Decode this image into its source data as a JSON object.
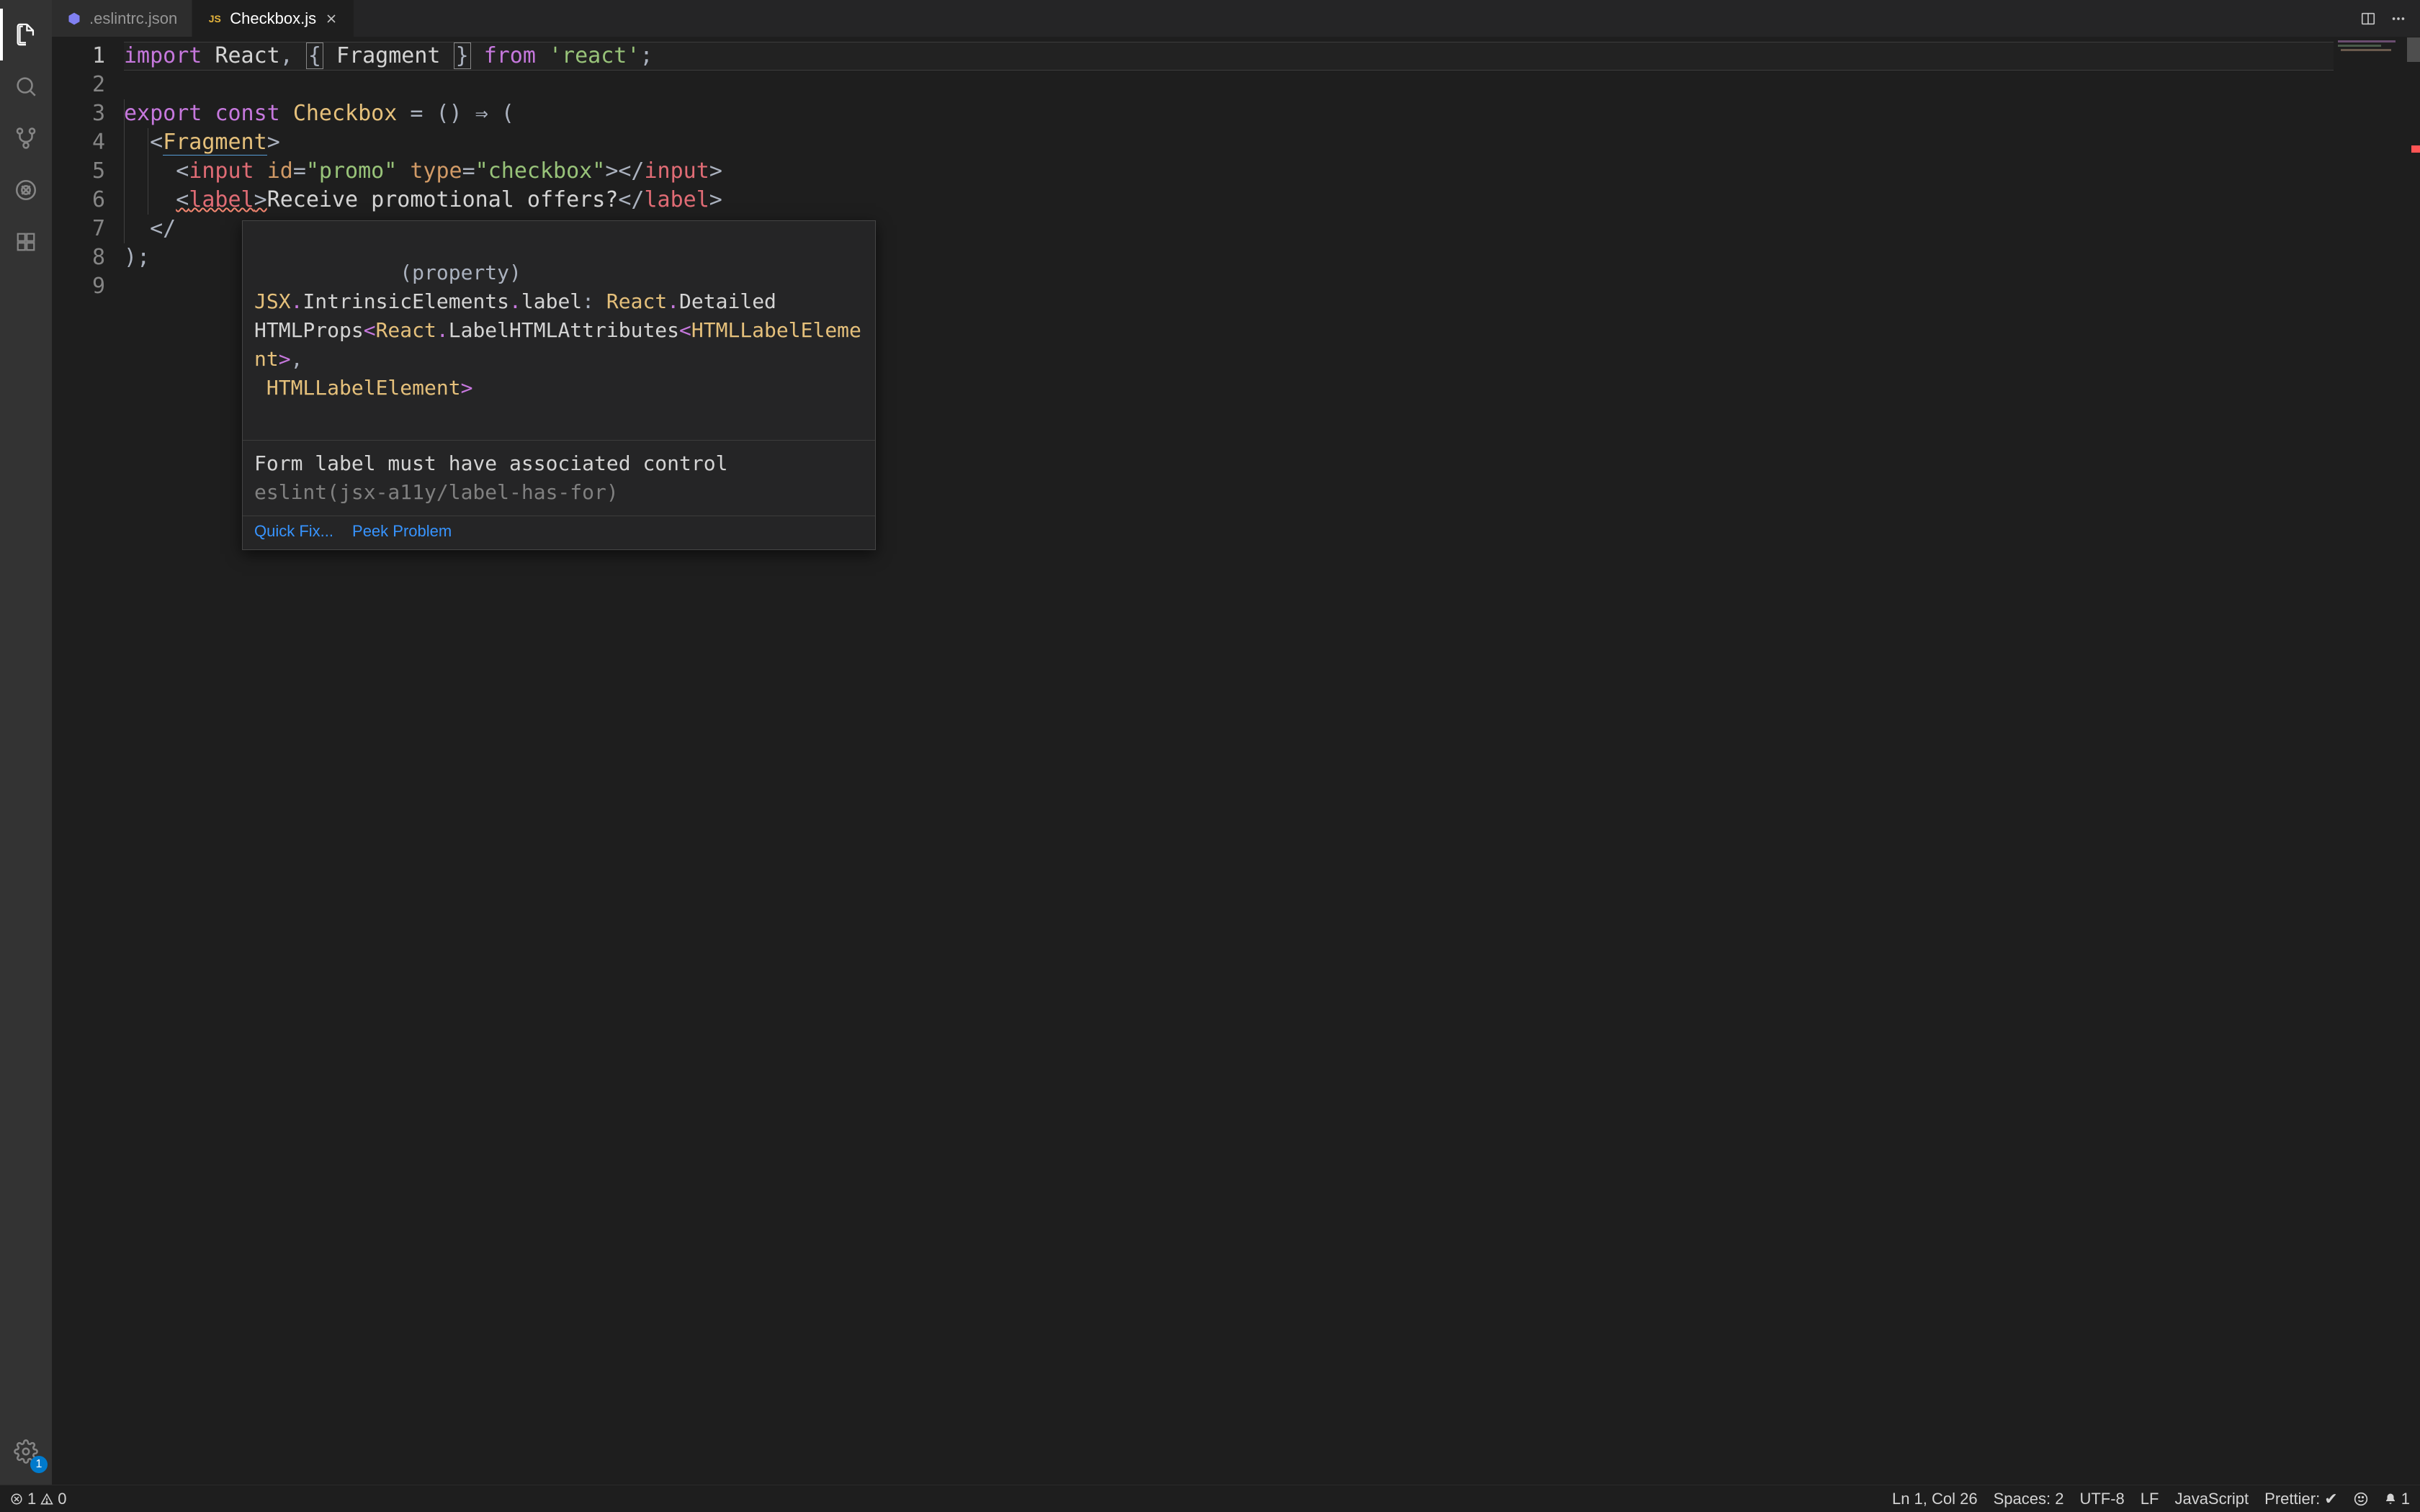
{
  "tabs": {
    "items": [
      {
        "icon": "eslint-icon",
        "label": ".eslintrc.json",
        "active": false
      },
      {
        "icon": "js-icon",
        "label": "Checkbox.js",
        "active": true
      }
    ]
  },
  "activity": {
    "settings_badge": "1"
  },
  "editor": {
    "line_numbers": [
      "1",
      "2",
      "3",
      "4",
      "5",
      "6",
      "7",
      "8",
      "9"
    ],
    "line1": {
      "import": "import",
      "react": "React",
      "comma": ",",
      "lb": "{",
      "fragment": "Fragment",
      "rb": "}",
      "from": "from",
      "pkg": "'react'",
      "semi": ";"
    },
    "line3": {
      "export": "export",
      "const": "const",
      "name": "Checkbox",
      "eq": "=",
      "lp": "(",
      "rp": ")",
      "arrow": "⇒",
      "open": "("
    },
    "line4": {
      "lt": "<",
      "name": "Fragment",
      "gt": ">"
    },
    "line5": {
      "open": "<",
      "tag": "input",
      "id_attr": "id",
      "eq1": "=",
      "id_val": "\"promo\"",
      "type_attr": "type",
      "eq2": "=",
      "type_val": "\"checkbox\"",
      "gt": ">",
      "close_open": "</",
      "close_tag": "input",
      "close_gt": ">"
    },
    "line6": {
      "open": "<",
      "tag": "label",
      "gt": ">",
      "text": "Receive promotional offers?",
      "close_open": "</",
      "close_tag": "label",
      "close_gt": ">"
    },
    "line7": {
      "close": "</"
    },
    "line8": {
      "rp": ")",
      "semi": ";"
    }
  },
  "hover": {
    "type_info": {
      "prefix": "(property) ",
      "ns1": "JSX",
      "dot1": ".",
      "p1": "IntrinsicElements",
      "dot2": ".",
      "p2": "label",
      "colon": ": ",
      "r1": "React",
      "dot3": ".",
      "p3": "Detailed",
      "line2a": "HTMLProps",
      "lt": "<",
      "r2": "React",
      "dot4": ".",
      "p4": "LabelHTMLAttributes",
      "lt2": "<",
      "el1": "HTMLLabelElement",
      "gt1": ">",
      "comma": ",",
      "line3a": " ",
      "el2": "HTMLLabelElement",
      "gt2": ">"
    },
    "message": "Form label must have associated control",
    "rule": "eslint(jsx-a11y/label-has-for)",
    "actions": {
      "quickfix": "Quick Fix...",
      "peek": "Peek Problem"
    }
  },
  "status": {
    "errors": "1",
    "warnings": "0",
    "cursor": "Ln 1, Col 26",
    "spaces": "Spaces: 2",
    "encoding": "UTF-8",
    "eol": "LF",
    "language": "JavaScript",
    "prettier": "Prettier: ✔",
    "bell": "1"
  }
}
